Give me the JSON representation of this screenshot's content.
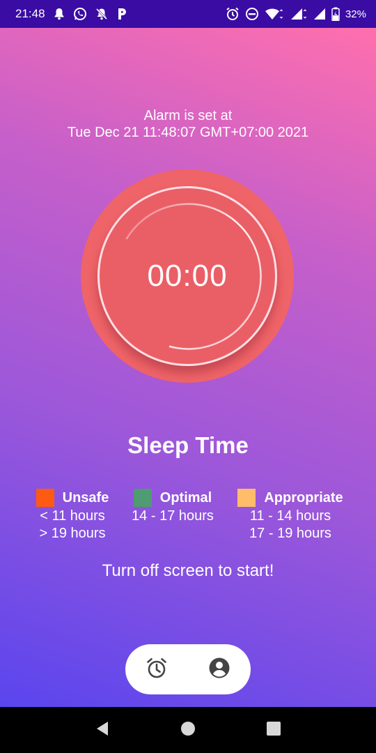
{
  "status_bar": {
    "time": "21:48",
    "battery": "32%",
    "left_icons": [
      "bell-icon",
      "whatsapp-icon",
      "muted-bell-icon",
      "p-app-icon"
    ],
    "right_icons": [
      "alarm-icon",
      "dnd-icon",
      "wifi-icon",
      "signal-icon",
      "signal-icon",
      "battery-icon"
    ]
  },
  "alarm": {
    "line1": "Alarm is set at",
    "line2": "Tue Dec 21 11:48:07 GMT+07:00 2021"
  },
  "timer": {
    "display": "00:00"
  },
  "sleep_title": "Sleep Time",
  "legend": [
    {
      "label": "Unsafe",
      "color": "#ff5a11",
      "ranges": [
        "< 11 hours",
        "> 19 hours"
      ]
    },
    {
      "label": "Optimal",
      "color": "#4f9b72",
      "ranges": [
        "14 - 17 hours"
      ]
    },
    {
      "label": "Appropriate",
      "color": "#ffbd69",
      "ranges": [
        "11 - 14 hours",
        "17 - 19 hours"
      ]
    }
  ],
  "hint": "Turn off screen to start!",
  "bottom_nav": {
    "items": [
      {
        "icon": "alarm-clock-icon"
      },
      {
        "icon": "account-icon"
      }
    ]
  },
  "system_nav": [
    "back-icon",
    "home-icon",
    "recents-icon"
  ],
  "colors": {
    "status_bar_bg": "#3a0ca3",
    "timer_outer": "#ef6468",
    "timer_inner": "#ea5f66",
    "icon_gray": "#444444"
  }
}
